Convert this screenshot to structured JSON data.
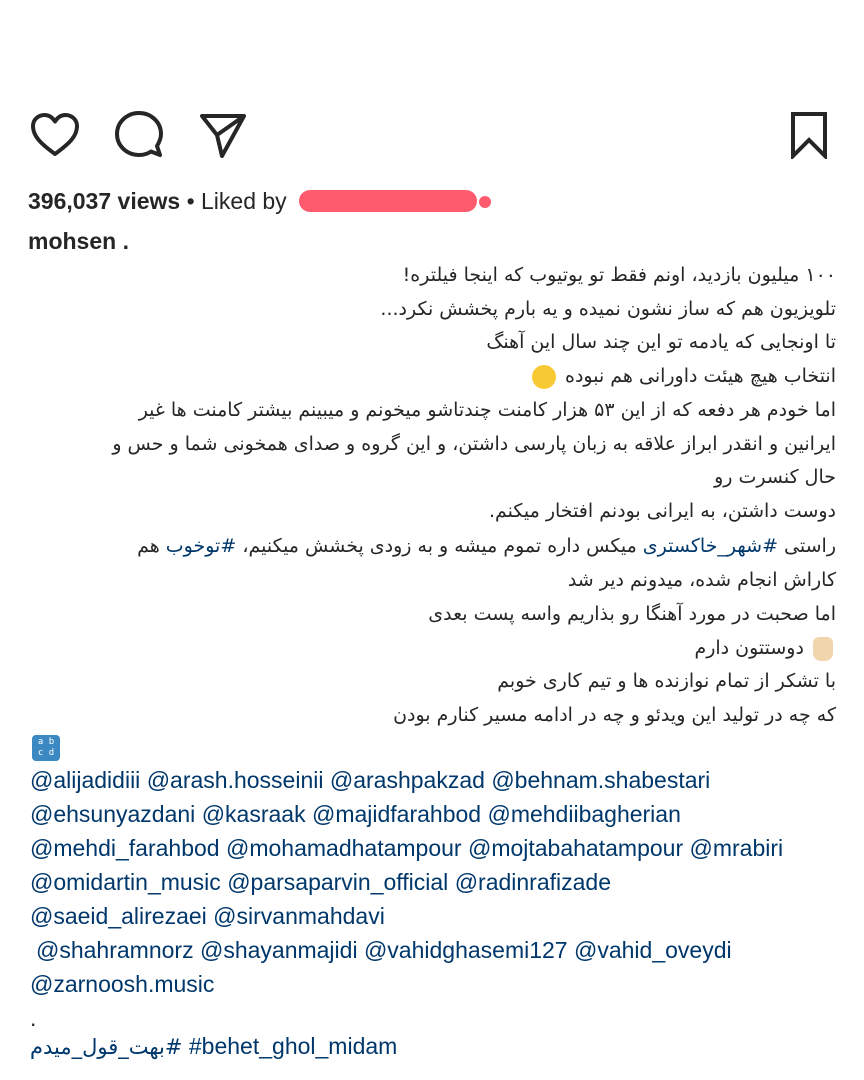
{
  "actions": {
    "like_icon": "heart-icon",
    "comment_icon": "comment-icon",
    "share_icon": "paper-plane-icon",
    "save_icon": "bookmark-icon"
  },
  "stats": {
    "views": "396,037 views",
    "liked_by": "• Liked by"
  },
  "post": {
    "username": "mohsen .",
    "caption_lines": [
      "۱۰۰ میلیون بازدید، اونم فقط تو یوتیوب که اینجا فیلتره!",
      "تلویزیون هم که ساز نشون نمیده و یه بارم پخشش نکرد...",
      "تا اونجایی که یادمه تو این چند سال این آهنگ",
      "انتخاب هیچ هیئت داورانی هم نبوده",
      "اما خودم هر دفعه که از این ۵۳ هزار کامنت چندتاشو میخونم و میبینم بیشتر کامنت ها غیر",
      "ایرانین و انقدر ابراز علاقه به زبان پارسی داشتن، و این گروه و صدای همخونی شما و حس و",
      "حال کنسرت رو",
      "دوست داشتن، به ایرانی بودنم افتخار میکنم.",
      "راستی",
      "میکس داره تموم میشه و به زودی پخشش میکنیم،",
      "هم",
      "کاراش انجام شده، میدونم دیر شد",
      "اما صحبت در مورد آهنگا رو بذاریم واسه پست بعدی",
      "دوستتون دارم",
      "با تشکر از تمام نوازنده ها و تیم کاری خوبم",
      "که چه در تولید این ویدئو و چه در ادامه مسیر کنارم بودن"
    ],
    "caption_tags": [
      "#شهر_خاکستری",
      "#توخوب"
    ],
    "abc_badge": "a b\nc d",
    "mentions": [
      [
        "@alijadidiii",
        "@arash.hosseinii",
        "@arashpakzad",
        "@behnam.shabestari"
      ],
      [
        "@ehsunyazdani",
        "@kasraak",
        "@majidfarahbod",
        "@mehdiibagherian"
      ],
      [
        "@mehdi_farahbod",
        "@mohamadhatampour",
        "@mojtabahatampour",
        "@mrabiri"
      ],
      [
        "@omidartin_music",
        "@parsaparvin_official",
        "@radinrafizade"
      ],
      [
        "@saeid_alirezaei",
        "@sirvanmahdavi"
      ],
      [
        "@shahramnorz",
        "@shayanmajidi",
        "@vahidghasemi127",
        "@vahid_oveydi"
      ],
      [
        "@zarnoosh.music"
      ]
    ],
    "dot": ".",
    "hashtags": [
      "#بهت_قول_میدم",
      "#behet_ghol_midam"
    ]
  }
}
